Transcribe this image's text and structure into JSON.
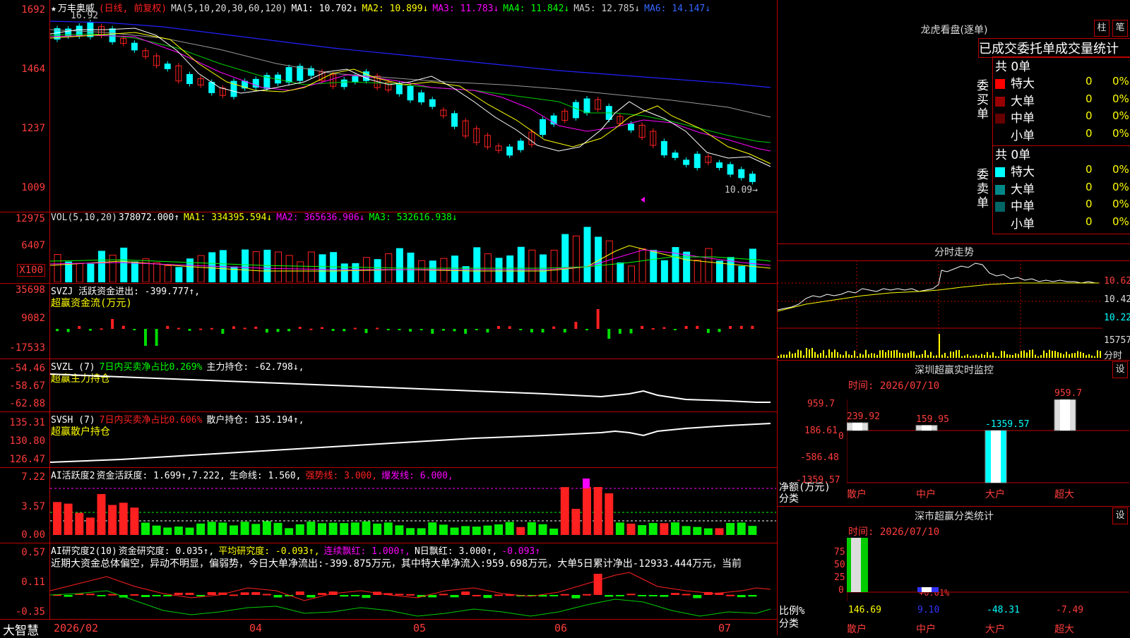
{
  "main": {
    "stock": "万丰奥威",
    "star": "★",
    "mode": "(日线, 前复权)",
    "ma_label": "MA(5,10,20,30,60,120)",
    "ma1": "MA1: 10.702↓",
    "ma2": "MA2: 10.899↓",
    "ma3": "MA3: 11.783↓",
    "ma4": "MA4: 11.842↓",
    "ma5": "MA5: 12.785↓",
    "ma6": "MA6: 14.147↓",
    "yaxis": [
      "1692",
      "1464",
      "1237",
      "1009"
    ],
    "high_mark": "16.92",
    "low_mark": "10.09→"
  },
  "vol": {
    "title": "VOL(5,10,20)",
    "value": "378072.000↑",
    "ma1": "MA1: 334395.594↓",
    "ma2": "MA2: 365636.906↓",
    "ma3": "MA3: 532616.938↓",
    "yaxis": [
      "12975",
      "6407"
    ],
    "unit": "X100"
  },
  "svzj": {
    "title": "SVZJ  活跃资金进出: -399.777↑,",
    "sub": "超赢资金流(万元)",
    "yaxis": [
      "35698",
      "9082",
      "-17533"
    ]
  },
  "svzl": {
    "title": "SVZL (7)",
    "ratio": "7日内买卖净占比0.269%",
    "hold": "主力持仓: -62.798↓,",
    "sub": "超赢主力持仓",
    "yaxis": [
      "-54.46",
      "-58.67",
      "-62.88"
    ]
  },
  "svsh": {
    "title": "SVSH (7)",
    "ratio": "7日内买卖净占比0.606%",
    "hold": "散户持仓: 135.194↑,",
    "sub": "超赢散户持仓",
    "yaxis": [
      "135.31",
      "130.80",
      "126.47"
    ]
  },
  "ai1": {
    "title": "AI活跃度2",
    "act": "资金活跃度: 1.699↑,7.222,",
    "life": "生命线: 1.560,",
    "strong": "强势线: 3.000,",
    "burst": "爆发线: 6.000,",
    "yaxis": [
      "7.22",
      "3.57",
      "0.00"
    ]
  },
  "ai2": {
    "title": "AI研究度2(10)",
    "a": "资金研究度: 0.035↑,",
    "b": "平均研究度: -0.093↑,",
    "c": "连续飘红: 1.000↑,",
    "d": "N日飘红: 3.000↑,",
    "e": "-0.093↑",
    "text": "近期大资金总体偏空，异动不明显，偏弱势，今日大单净流出:-399.875万元，其中特大单净流入:959.698万元，大单5日累计净出-12933.444万元，当前",
    "yaxis": [
      "0.57",
      "0.11",
      "-0.35"
    ]
  },
  "xaxis": {
    "brand": "大智慧",
    "labels": [
      "2026/02",
      "04",
      "05",
      "06",
      "07"
    ]
  },
  "right": {
    "dragon_title": "龙虎看盘(逐单)",
    "btn1": "柱",
    "btn2": "笔",
    "stat_title": "已成交委托单成交量统计",
    "buy_label": "委买单",
    "sell_label": "委卖单",
    "buy_total": "共 0单",
    "sell_total": "共 0单",
    "buy_rows": [
      {
        "name": "特大",
        "n": "0",
        "p": "0%",
        "color": "#ff0000"
      },
      {
        "name": "大单",
        "n": "0",
        "p": "0%",
        "color": "#990000"
      },
      {
        "name": "中单",
        "n": "0",
        "p": "0%",
        "color": "#660000"
      },
      {
        "name": "小单",
        "n": "0",
        "p": "0%",
        "color": "#000000"
      }
    ],
    "sell_rows": [
      {
        "name": "特大",
        "n": "0",
        "p": "0%",
        "color": "#00ffff"
      },
      {
        "name": "大单",
        "n": "0",
        "p": "0%",
        "color": "#008888"
      },
      {
        "name": "中单",
        "n": "0",
        "p": "0%",
        "color": "#006666"
      },
      {
        "name": "小单",
        "n": "0",
        "p": "0%",
        "color": "#000000"
      }
    ],
    "intraday_title": "分时走势",
    "intraday_axis": [
      "10.62",
      "10.42",
      "10.22",
      "15757",
      "分时"
    ],
    "monitor_title": "深圳超赢实时监控",
    "monitor_btn": "设",
    "monitor_time": "时间: 2026/07/10",
    "monitor_axis": [
      "959.7",
      "186.61",
      "0",
      "-586.48",
      "-1359.57"
    ],
    "monitor_left1": "净额(万元)",
    "monitor_left2": "分类",
    "monitor_vals": [
      "239.92",
      "159.95",
      "-1359.57",
      "959.7"
    ],
    "cats": [
      "散户",
      "中户",
      "大户",
      "超大"
    ],
    "class_title": "深市超赢分类统计",
    "class_btn": "设",
    "class_time": "时间: 2026/07/10",
    "class_axis": [
      "75",
      "50",
      "25",
      "0"
    ],
    "class_left1": "比例%",
    "class_left2": "分类",
    "class_vals": [
      "146.69",
      "9.10",
      "-48.31",
      "-7.49"
    ],
    "class_small": "+0.01%"
  },
  "colors": {
    "up": "#ff2020",
    "down": "#00ffff",
    "ma1": "#ffffff",
    "ma2": "#ffff00",
    "ma3": "#ff00ff",
    "ma4": "#00ff00",
    "ma5": "#aaaaaa",
    "ma6": "#0000ff",
    "border": "#b00000"
  }
}
